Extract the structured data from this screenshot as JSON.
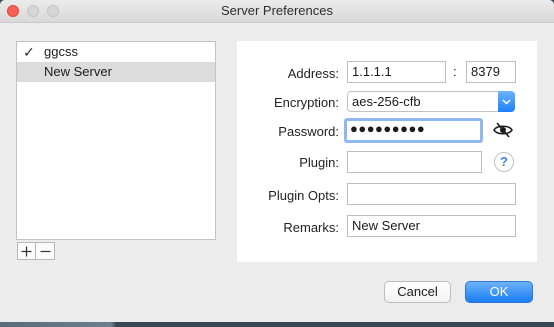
{
  "window": {
    "title": "Server Preferences"
  },
  "server_list": {
    "items": [
      {
        "label": "ggcss",
        "checked": true,
        "selected": false
      },
      {
        "label": "New Server",
        "checked": false,
        "selected": true
      }
    ],
    "add_glyph": "+",
    "remove_glyph": "−"
  },
  "form": {
    "address_label": "Address:",
    "address_value": "1.1.1.1",
    "port_separator": ":",
    "port_value": "8379",
    "encryption_label": "Encryption:",
    "encryption_value": "aes-256-cfb",
    "password_label": "Password:",
    "password_value": "●●●●●●●●●",
    "plugin_label": "Plugin:",
    "plugin_value": "",
    "plugin_opts_label": "Plugin Opts:",
    "plugin_opts_value": "",
    "remarks_label": "Remarks:",
    "remarks_value": "New Server",
    "help_glyph": "?"
  },
  "buttons": {
    "cancel_label": "Cancel",
    "ok_label": "OK"
  },
  "colors": {
    "accent": "#1a7cf5",
    "close_button": "#fc5f57",
    "focus_ring": "#8fb8ee"
  },
  "icons": {
    "check": "checkmark-icon",
    "password_visibility": "eye-slash-icon",
    "encryption_dropdown": "chevron-down-icon",
    "help": "help-icon"
  }
}
